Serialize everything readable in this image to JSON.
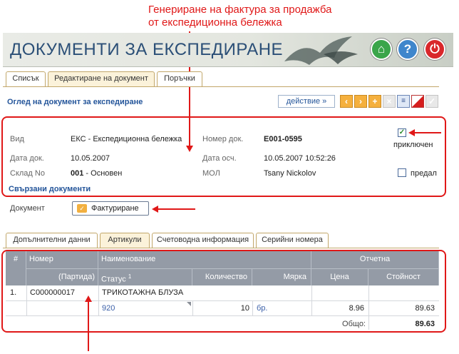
{
  "annotation": {
    "line1": "Генериране на фактура за продажба",
    "line2": "от експедиционна бележка"
  },
  "header": {
    "title": "ДОКУМЕНТИ ЗА ЕКСПЕДИРАНЕ",
    "home_glyph": "⌂",
    "help_glyph": "?",
    "power_glyph": "⏻"
  },
  "tabs": [
    "Списък",
    "Редактиране на документ",
    "Поръчки"
  ],
  "section_title": "Оглед на документ за експедиране",
  "action_label": "действие »",
  "toolbar": {
    "prev": "‹",
    "next": "›",
    "add": "+",
    "delete": "×",
    "print": "≡",
    "confirm": "✓"
  },
  "doc": {
    "type_label": "Вид",
    "type_value": "ЕКС - Експедиционна бележка",
    "number_label": "Номер док.",
    "number_value": "E001-0595",
    "date_label": "Дата док.",
    "date_value": "10.05.2007",
    "posted_label": "Дата осч.",
    "posted_value": "10.05.2007 10:52:26",
    "warehouse_label": "Склад No",
    "warehouse_code": "001",
    "warehouse_name": " - Основен",
    "mol_label": "МОЛ",
    "mol_value": "Tsany Nickolov",
    "closed_label": "приключен",
    "closed_checked": true,
    "submitted_label": "предал",
    "submitted_checked": false,
    "related_docs": "Свързани документи"
  },
  "document_row": {
    "label": "Документ",
    "button": "Фактуриране"
  },
  "subtabs": [
    "Допълнителни данни",
    "Артикули",
    "Счетоводна информация",
    "Серийни номера"
  ],
  "grid": {
    "h_hash": "#",
    "h_number": "Номер",
    "h_name": "Наименование",
    "h_report": "Отчетна",
    "h_batch": "(Партида)",
    "h_status": "Статус",
    "h_status_sup": "1",
    "h_qty": "Количество",
    "h_unit": "Мярка",
    "h_price": "Цена",
    "h_value": "Стойност",
    "row": {
      "idx": "1.",
      "number": "C000000017",
      "name": "ТРИКОТАЖНА БЛУЗА",
      "status": "920",
      "qty": "10",
      "unit": "бр.",
      "price": "8.96",
      "value": "89.63"
    },
    "total_label": "Общо:",
    "total_value": "89.63"
  },
  "colors": {
    "accent": "#24559a",
    "annotation": "#e01818",
    "grid_header": "#949ba6"
  }
}
